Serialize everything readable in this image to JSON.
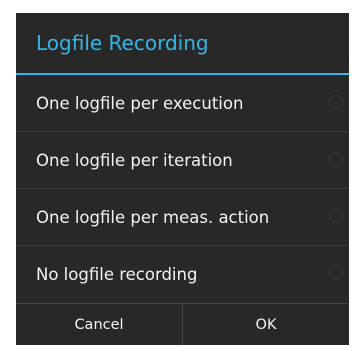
{
  "dialog": {
    "title": "Logfile Recording",
    "accent_color": "#33b5e5",
    "background_color": "#282828",
    "options": [
      {
        "label": "One logfile per execution",
        "selected": false
      },
      {
        "label": "One logfile per iteration",
        "selected": false
      },
      {
        "label": "One logfile per meas. action",
        "selected": false
      },
      {
        "label": "No logfile recording",
        "selected": false
      }
    ],
    "buttons": {
      "cancel": "Cancel",
      "ok": "OK"
    }
  }
}
